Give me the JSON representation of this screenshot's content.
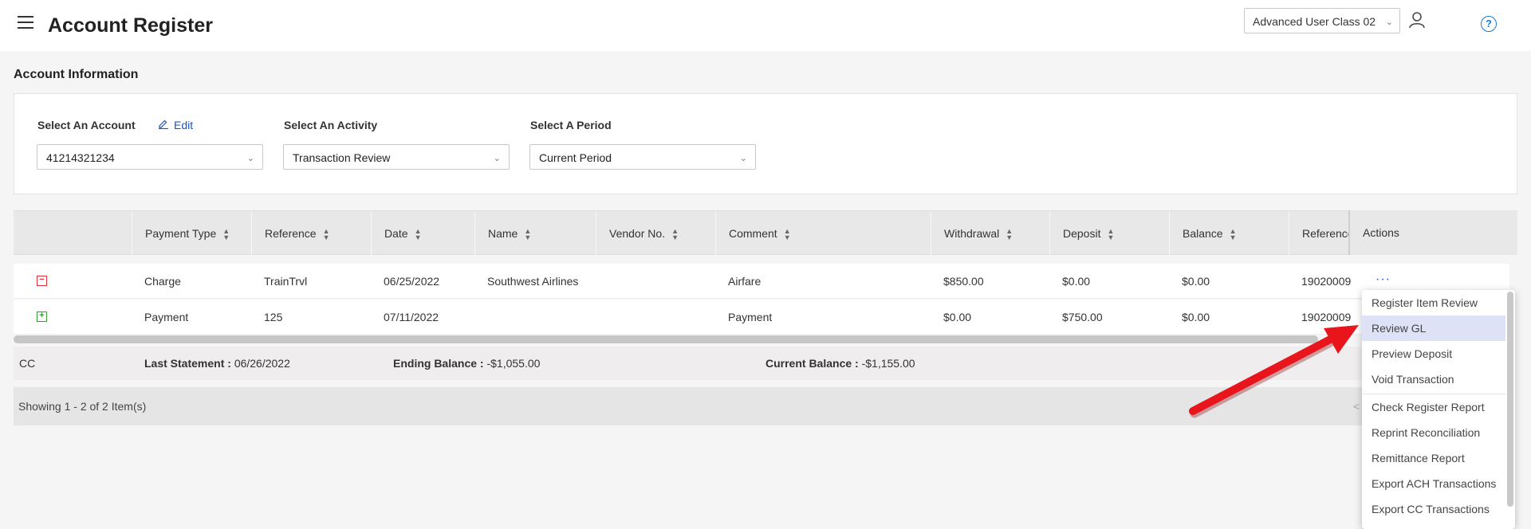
{
  "app": {
    "title": "Account Register",
    "user_class": "Advanced User Class 02",
    "help_glyph": "?"
  },
  "section": {
    "title": "Account Information"
  },
  "filters": {
    "account_label": "Select An Account",
    "edit_label": "Edit",
    "account_value": "41214321234",
    "activity_label": "Select An Activity",
    "activity_value": "Transaction Review",
    "period_label": "Select A Period",
    "period_value": "Current Period"
  },
  "table": {
    "columns": [
      "Payment Type",
      "Reference",
      "Date",
      "Name",
      "Vendor No.",
      "Comment",
      "Withdrawal",
      "Deposit",
      "Balance",
      "Reference"
    ],
    "actions_header": "Actions",
    "rows": [
      {
        "expander": "−",
        "payment_type": "Charge",
        "reference": "TrainTrvl",
        "date": "06/25/2022",
        "name": "Southwest Airlines",
        "vendor_no": "",
        "comment": "Airfare",
        "withdrawal": "$850.00",
        "deposit": "$0.00",
        "balance": "$0.00",
        "reference2": "19020009",
        "actions": "···"
      },
      {
        "expander": "+",
        "payment_type": "Payment",
        "reference": "125",
        "date": "07/11/2022",
        "name": "",
        "vendor_no": "",
        "comment": "Payment",
        "withdrawal": "$0.00",
        "deposit": "$750.00",
        "balance": "$0.00",
        "reference2": "19020009",
        "actions": ""
      }
    ]
  },
  "summary": {
    "type": "CC",
    "last_statement_label": "Last Statement :",
    "last_statement_value": "06/26/2022",
    "ending_balance_label": "Ending Balance :",
    "ending_balance_value": "-$1,055.00",
    "current_balance_label": "Current Balance :",
    "current_balance_value": "-$1,155.00"
  },
  "pager": {
    "text": "Showing 1 - 2 of 2 Item(s)",
    "prev_glyph": "<"
  },
  "menu": {
    "items": [
      "Register Item Review",
      "Review GL",
      "Preview Deposit",
      "Void Transaction",
      "Check Register Report",
      "Reprint Reconciliation",
      "Remittance Report",
      "Export ACH Transactions",
      "Export CC Transactions"
    ],
    "active_index": 1
  },
  "colors": {
    "arrow": "#e8161c",
    "link": "#1a56c9",
    "help": "#1a7bd6",
    "menu_active": "#dde2f7"
  }
}
